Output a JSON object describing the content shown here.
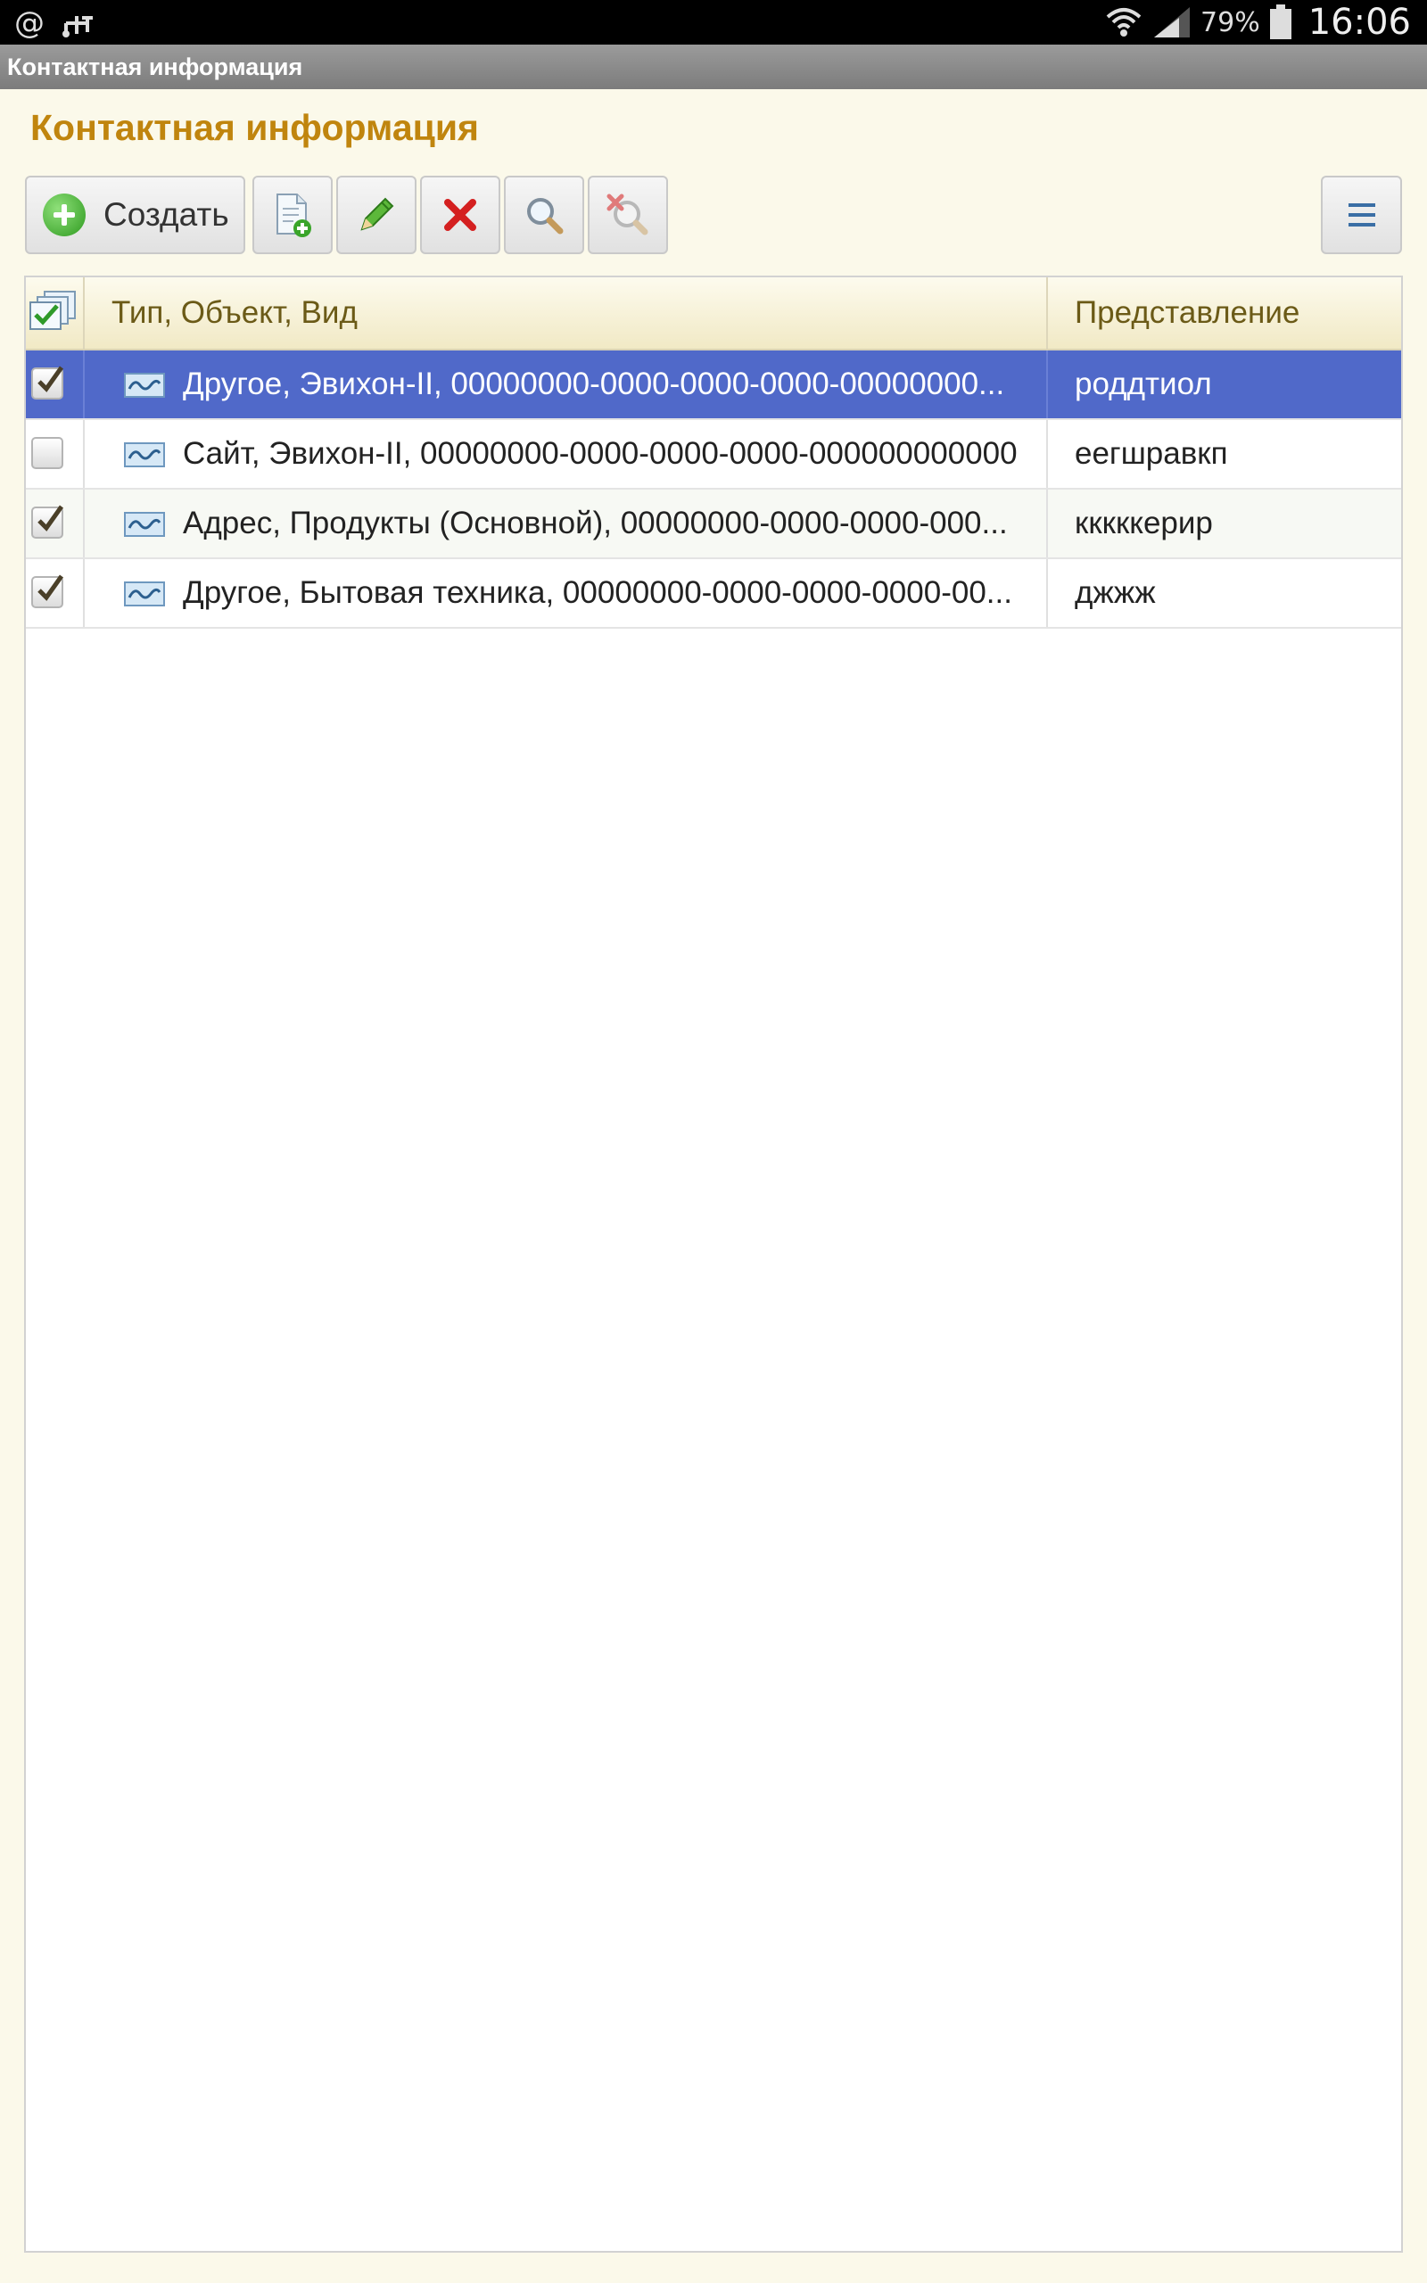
{
  "status_bar": {
    "battery_percent": "79%",
    "time": "16:06",
    "left_icons": [
      "at-sign-icon",
      "usb-icon"
    ],
    "right_icons": [
      "wifi-icon",
      "signal-icon",
      "battery-icon"
    ]
  },
  "app_bar": {
    "title": "Контактная информация"
  },
  "form": {
    "title": "Контактная информация"
  },
  "toolbar": {
    "create_label": "Создать",
    "buttons": [
      "create-button",
      "copy-button",
      "edit-button",
      "delete-button",
      "find-button",
      "cancel-search-button",
      "more-menu-button"
    ]
  },
  "table": {
    "columns": {
      "main": "Тип, Объект, Вид",
      "repr": "Представление"
    },
    "rows": [
      {
        "checked": true,
        "main": "Другое, Эвихон-II, 00000000-0000-0000-0000-00000000...",
        "repr": "роддтиол",
        "selected": true
      },
      {
        "checked": false,
        "main": "Сайт, Эвихон-II, 00000000-0000-0000-0000-000000000000",
        "repr": "еегшравкп",
        "selected": false
      },
      {
        "checked": true,
        "main": "Адрес, Продукты (Основной), 00000000-0000-0000-000...",
        "repr": "кккккерир",
        "selected": false
      },
      {
        "checked": true,
        "main": "Другое, Бытовая техника, 00000000-0000-0000-0000-00...",
        "repr": "джжж",
        "selected": false
      }
    ]
  },
  "colors": {
    "title": "#c0850e",
    "selected_row": "#5069c9",
    "background": "#fbf9ea"
  }
}
